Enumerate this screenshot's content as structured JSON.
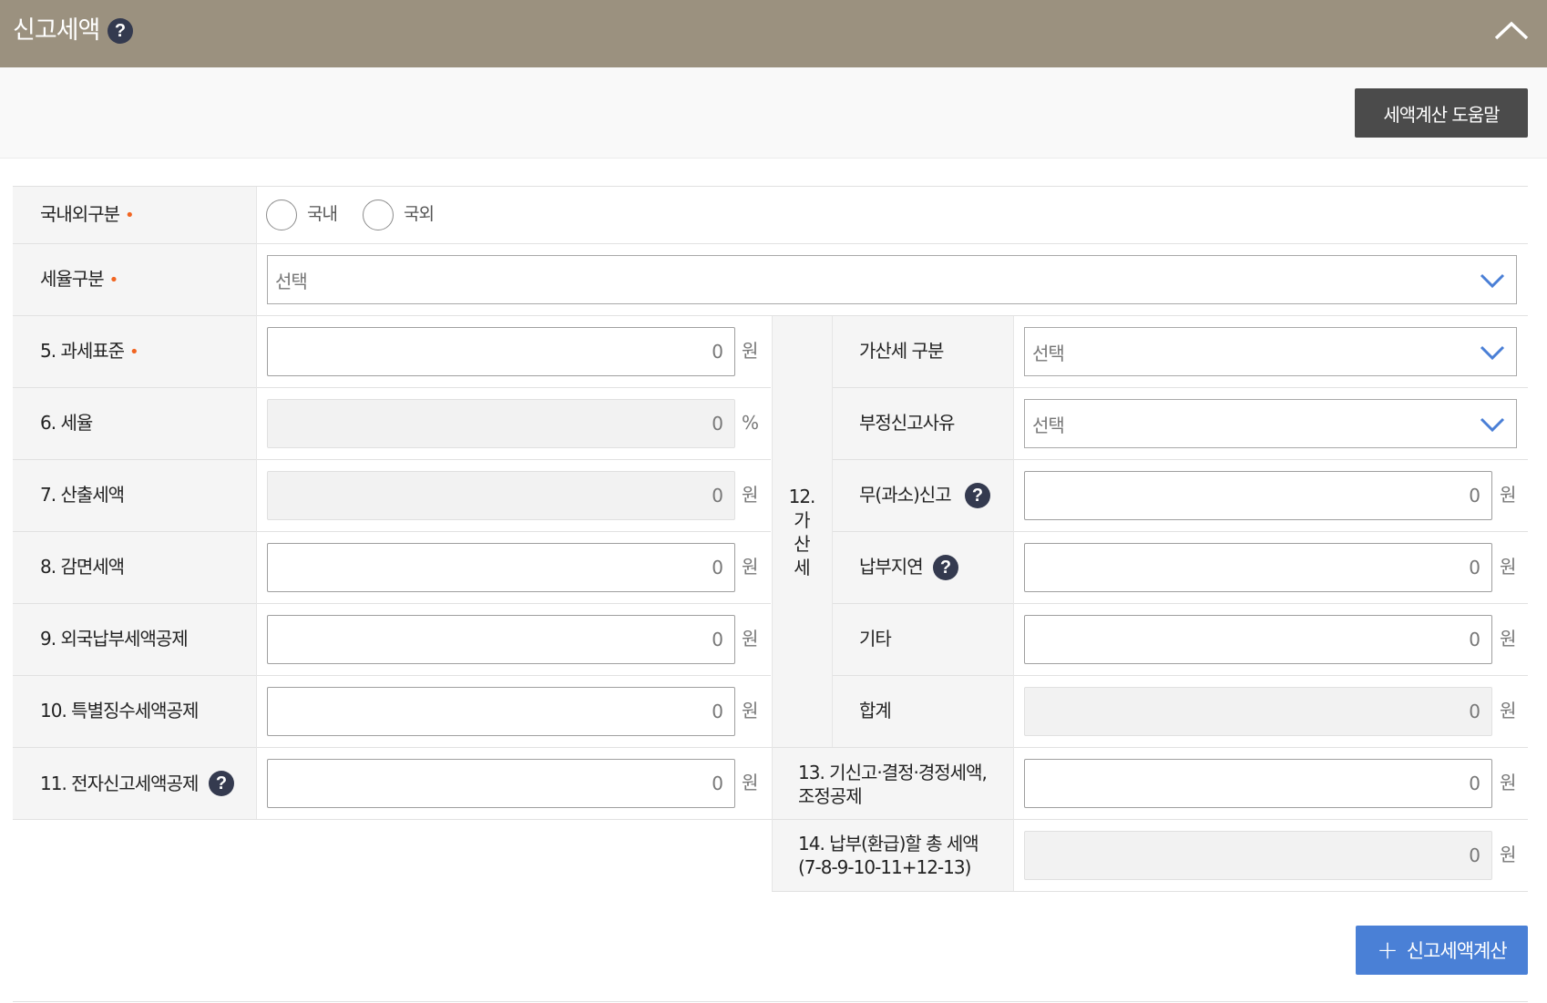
{
  "header": {
    "title": "신고세액",
    "help": "?"
  },
  "toolbar": {
    "help_button": "세액계산 도움말"
  },
  "domestic": {
    "label": "국내외구분",
    "required": "•",
    "options": [
      "국내",
      "국외"
    ]
  },
  "tax_rate_type": {
    "label": "세율구분",
    "required": "•",
    "value": "선택"
  },
  "left_rows": [
    {
      "label": "5. 과세표준",
      "required": "•",
      "value": "0",
      "unit": "원",
      "readonly": false
    },
    {
      "label": "6. 세율",
      "value": "0",
      "unit": "%",
      "readonly": true
    },
    {
      "label": "7. 산출세액",
      "value": "0",
      "unit": "원",
      "readonly": true
    },
    {
      "label": "8. 감면세액",
      "value": "0",
      "unit": "원",
      "readonly": false
    },
    {
      "label": "9. 외국납부세액공제",
      "value": "0",
      "unit": "원",
      "readonly": false
    },
    {
      "label": "10. 특별징수세액공제",
      "value": "0",
      "unit": "원",
      "readonly": false
    },
    {
      "label": "11. 전자신고세액공제",
      "help": "?",
      "value": "0",
      "unit": "원",
      "readonly": false
    }
  ],
  "penalty": {
    "group_label": "12. 가산세",
    "type": {
      "label": "가산세 구분",
      "value": "선택"
    },
    "reason": {
      "label": "부정신고사유",
      "value": "선택"
    },
    "rows": [
      {
        "label": "무(과소)신고",
        "help": "?",
        "value": "0",
        "unit": "원",
        "readonly": false
      },
      {
        "label": "납부지연",
        "help": "?",
        "value": "0",
        "unit": "원",
        "readonly": false
      },
      {
        "label": "기타",
        "value": "0",
        "unit": "원",
        "readonly": false
      },
      {
        "label": "합계",
        "value": "0",
        "unit": "원",
        "readonly": true
      }
    ]
  },
  "row13": {
    "label_line1": "13. 기신고·결정·경정세액,",
    "label_line2": "조정공제",
    "value": "0",
    "unit": "원"
  },
  "row14": {
    "label_line1": "14. 납부(환급)할 총 세액",
    "label_line2": "(7-8-9-10-11+12-13)",
    "value": "0",
    "unit": "원"
  },
  "calc_button": {
    "icon": "+",
    "label": "신고세액계산"
  }
}
